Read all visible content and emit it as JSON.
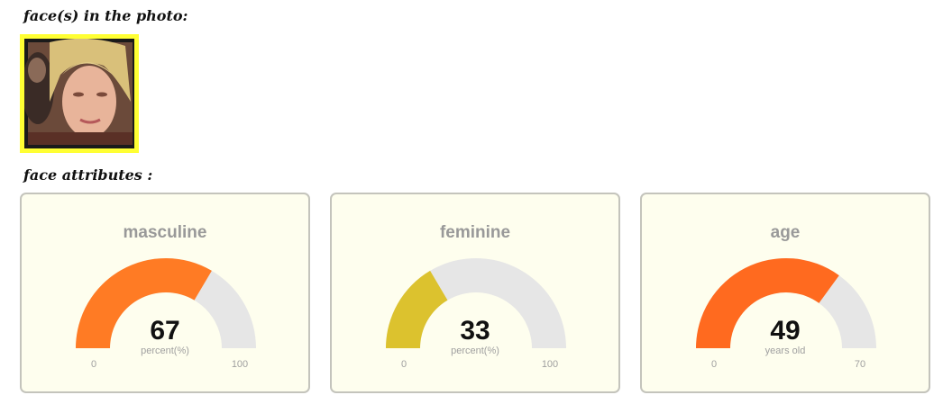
{
  "headings": {
    "photo": "face(s) in the photo:",
    "attributes": "face attributes :"
  },
  "face_thumbnail": {
    "frame_color": "#ffff33"
  },
  "gauges": [
    {
      "title": "masculine",
      "value": 67,
      "unit": "percent(%)",
      "min": 0,
      "max": 100,
      "color": "#ff7b24"
    },
    {
      "title": "feminine",
      "value": 33,
      "unit": "percent(%)",
      "min": 0,
      "max": 100,
      "color": "#dcc22e"
    },
    {
      "title": "age",
      "value": 49,
      "unit": "years old",
      "min": 0,
      "max": 70,
      "color": "#ff6a1f"
    }
  ]
}
